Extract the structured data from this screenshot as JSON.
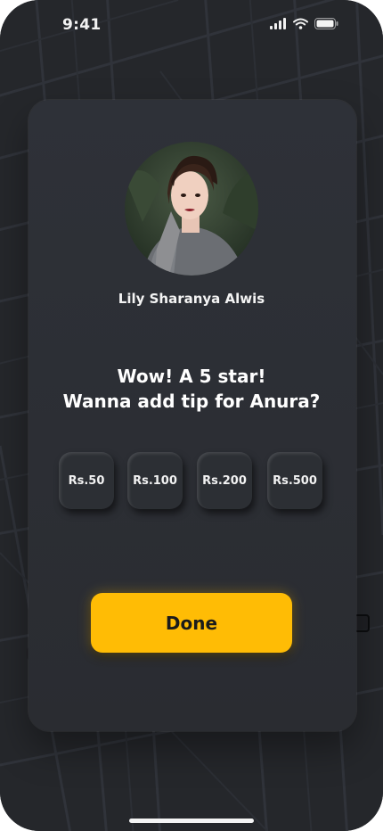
{
  "status_bar": {
    "time": "9:41",
    "icons": [
      "signal-icon",
      "wifi-icon",
      "battery-icon"
    ]
  },
  "driver": {
    "name": "Lily Sharanya Alwis",
    "avatar": "driver-photo"
  },
  "rating_prompt": {
    "line1": "Wow! A 5 star!",
    "line2": "Wanna add tip for Anura?"
  },
  "tips": [
    {
      "label": "Rs.50"
    },
    {
      "label": "Rs.100"
    },
    {
      "label": "Rs.200"
    },
    {
      "label": "Rs.500"
    }
  ],
  "done_button": {
    "label": "Done"
  },
  "colors": {
    "background": "#25272b",
    "card": "#2d3036",
    "accent": "#ffbc05",
    "text": "#ffffff"
  }
}
